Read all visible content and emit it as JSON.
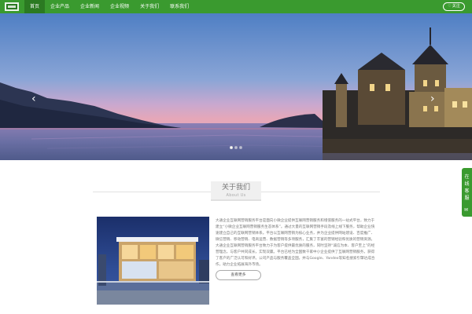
{
  "nav": {
    "items": [
      {
        "label": "首页",
        "active": true
      },
      {
        "label": "企业产品",
        "active": false
      },
      {
        "label": "企业新闻",
        "active": false
      },
      {
        "label": "企业视频",
        "active": false
      },
      {
        "label": "关于我们",
        "active": false
      },
      {
        "label": "联系我们",
        "active": false
      }
    ],
    "follow": {
      "icon": "heart-icon",
      "label": "关注"
    }
  },
  "banner": {
    "prev_icon": "chevron-left-icon",
    "next_icon": "chevron-right-icon",
    "slide_count": 3,
    "active_slide": 1
  },
  "about": {
    "title": "关于我们",
    "subtitle": "About Us",
    "description": "大通企业互联网营销服务平台是面向小微企业提供互联网营销服务和增值服务的一站式平台，致力于建立“小微企业互联网营销服务生态体系”。通过大量的互联网营销手段及线上线下服务，帮助企业快速建立自己的互联网营销体系。平台以互联网营销为核心业务，并为企业提供网站建设、百度推广、微信营销、移动营销、电商运营、数据营销等多项服务，汇集了丰富的营销经验和优质的营销资源。大通企业互联网营销服务平台致力于为客户提供最优质的服务，同时坚持“诚信为本、客户至上”的经营理念，与客户共同成长，实现双赢。平台已经为全国数千家中小企业提供了互联网营销服务，获得了客户的广泛认可和好评。公司产品与服务覆盖全国，并与Google、Yandex等知名搜索引擎达成合作，助力企业拓展海外市场。",
    "more_label": "查看更多"
  },
  "side_service": {
    "label": "在线客服",
    "icon": "chat-icon"
  },
  "colors": {
    "brand_green": "#3a9a2f",
    "nav_active": "#2b7a22"
  }
}
